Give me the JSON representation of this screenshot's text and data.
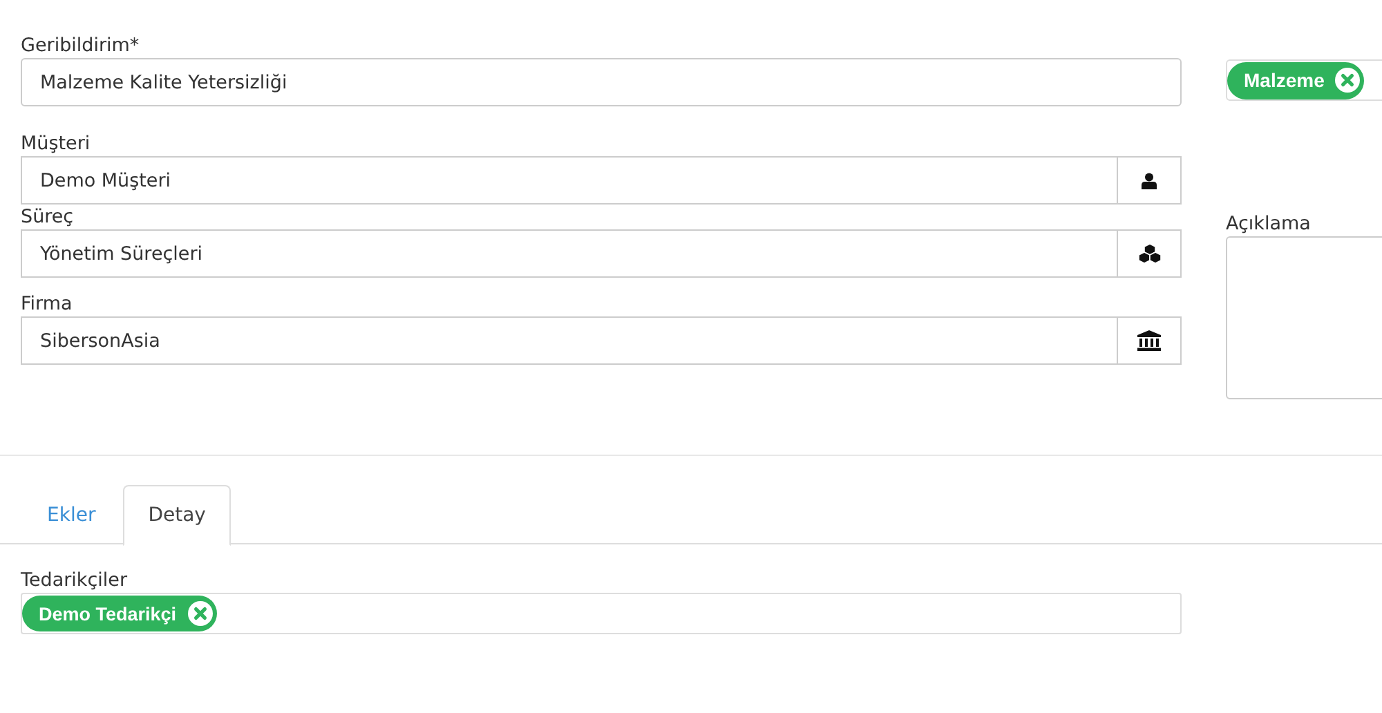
{
  "feedback": {
    "label": "Geribildirim*",
    "value": "Malzeme Kalite Yetersizliği"
  },
  "category_tags": [
    {
      "label": "Malzeme"
    }
  ],
  "fields": [
    {
      "label": "Müşteri",
      "value": "Demo Müşteri",
      "kind": "person"
    },
    {
      "label": "Süreç",
      "value": "Yönetim Süreçleri",
      "kind": "process"
    },
    {
      "label": "Firma",
      "value": "SibersonAsia",
      "kind": "company"
    }
  ],
  "description": {
    "label": "Açıklama"
  },
  "tabs": [
    {
      "label": "Ekler",
      "selected": false
    },
    {
      "label": "Detay",
      "selected": true
    }
  ],
  "suppliers": {
    "label": "Tedarikçiler",
    "tags": [
      {
        "label": "Demo Tedarikçi"
      }
    ]
  }
}
